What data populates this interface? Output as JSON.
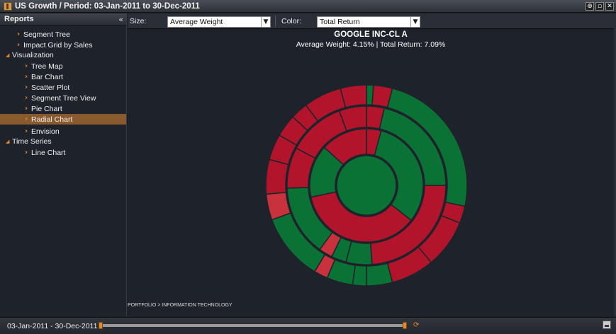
{
  "window": {
    "title": "US Growth / Period: 03-Jan-2011 to 30-Dec-2011",
    "buttons": [
      "pin",
      "dock",
      "close"
    ]
  },
  "sidebar": {
    "header": "Reports",
    "items": [
      {
        "label": "Segment Tree",
        "type": "leaf",
        "level": 1
      },
      {
        "label": "Impact Grid by Sales",
        "type": "leaf",
        "level": 1
      },
      {
        "label": "Visualization",
        "type": "group",
        "level": 0
      },
      {
        "label": "Tree Map",
        "type": "leaf",
        "level": 2
      },
      {
        "label": "Bar Chart",
        "type": "leaf",
        "level": 2
      },
      {
        "label": "Scatter Plot",
        "type": "leaf",
        "level": 2
      },
      {
        "label": "Segment Tree View",
        "type": "leaf",
        "level": 2
      },
      {
        "label": "Pie Chart",
        "type": "leaf",
        "level": 2
      },
      {
        "label": "Radial Chart",
        "type": "leaf",
        "level": 2,
        "selected": true
      },
      {
        "label": "Envision",
        "type": "leaf",
        "level": 2
      },
      {
        "label": "Time Series",
        "type": "group",
        "level": 0
      },
      {
        "label": "Line Chart",
        "type": "leaf",
        "level": 2
      }
    ]
  },
  "toolbar": {
    "size_label": "Size:",
    "size_value": "Average Weight",
    "color_label": "Color:",
    "color_value": "Total Return"
  },
  "chart": {
    "title": "GOOGLE INC-CL A",
    "subtitle": "Average Weight: 4.15% | Total Return: 7.09%",
    "breadcrumb": "PORTFOLIO > INFORMATION TECHNOLOGY"
  },
  "colors": {
    "positive": "#0b7236",
    "negative": "#b2142c",
    "negative_light": "#c8323c",
    "accent": "#e8882a"
  },
  "chart_data": {
    "type": "sunburst",
    "rings": [
      [
        {
          "start": 0,
          "end": 360,
          "color": "positive"
        }
      ],
      [
        {
          "start": 0,
          "end": 15,
          "color": "negative"
        },
        {
          "start": 15,
          "end": 128,
          "color": "positive"
        },
        {
          "start": 128,
          "end": 258,
          "color": "negative"
        },
        {
          "start": 258,
          "end": 312,
          "color": "positive"
        },
        {
          "start": 312,
          "end": 360,
          "color": "negative"
        }
      ],
      [
        {
          "start": 0,
          "end": 13,
          "color": "negative"
        },
        {
          "start": 13,
          "end": 90,
          "color": "positive"
        },
        {
          "start": 90,
          "end": 176,
          "color": "negative"
        },
        {
          "start": 176,
          "end": 195,
          "color": "positive"
        },
        {
          "start": 195,
          "end": 206,
          "color": "positive"
        },
        {
          "start": 206,
          "end": 216,
          "color": "negative_light"
        },
        {
          "start": 216,
          "end": 268,
          "color": "positive"
        },
        {
          "start": 268,
          "end": 298,
          "color": "negative"
        },
        {
          "start": 298,
          "end": 340,
          "color": "negative"
        },
        {
          "start": 340,
          "end": 360,
          "color": "negative"
        }
      ],
      [
        {
          "start": 0,
          "end": 4,
          "color": "positive"
        },
        {
          "start": 4,
          "end": 15,
          "color": "negative"
        },
        {
          "start": 15,
          "end": 102,
          "color": "positive"
        },
        {
          "start": 102,
          "end": 112,
          "color": "negative"
        },
        {
          "start": 112,
          "end": 140,
          "color": "negative"
        },
        {
          "start": 140,
          "end": 165,
          "color": "negative"
        },
        {
          "start": 165,
          "end": 180,
          "color": "positive"
        },
        {
          "start": 180,
          "end": 188,
          "color": "positive"
        },
        {
          "start": 188,
          "end": 203,
          "color": "positive"
        },
        {
          "start": 203,
          "end": 211,
          "color": "negative_light"
        },
        {
          "start": 211,
          "end": 250,
          "color": "positive"
        },
        {
          "start": 250,
          "end": 265,
          "color": "negative_light"
        },
        {
          "start": 265,
          "end": 285,
          "color": "negative"
        },
        {
          "start": 285,
          "end": 300,
          "color": "negative"
        },
        {
          "start": 300,
          "end": 313,
          "color": "negative"
        },
        {
          "start": 313,
          "end": 323,
          "color": "negative"
        },
        {
          "start": 323,
          "end": 345,
          "color": "negative"
        },
        {
          "start": 345,
          "end": 360,
          "color": "negative"
        }
      ]
    ]
  },
  "status": {
    "date_range": "03-Jan-2011 - 30-Dec-2011",
    "slider_start": 0,
    "slider_end": 1
  }
}
